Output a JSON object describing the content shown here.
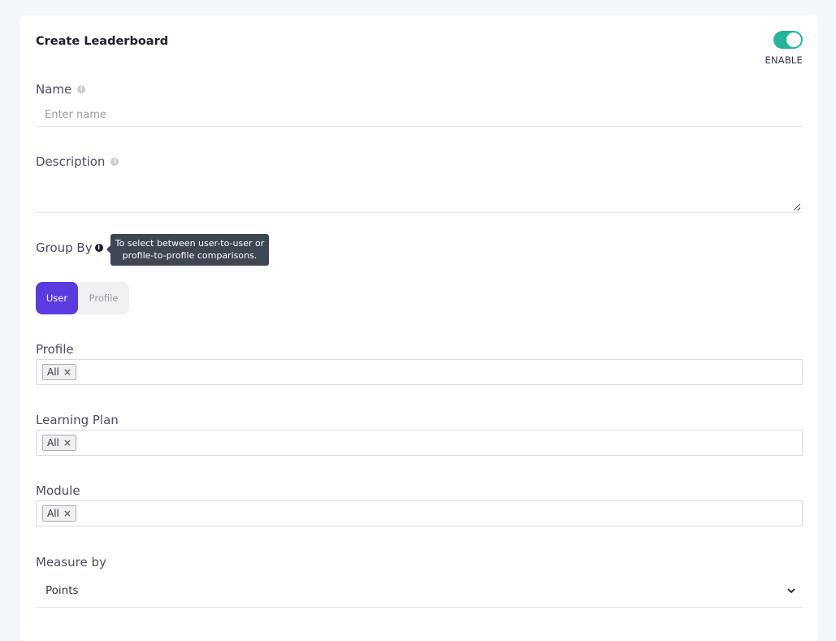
{
  "form": {
    "title": "Create Leaderboard",
    "enable_label": "ENABLE",
    "enabled": true
  },
  "fields": {
    "name": {
      "label": "Name",
      "placeholder": "Enter name",
      "value": ""
    },
    "description": {
      "label": "Description",
      "value": ""
    },
    "group_by": {
      "label": "Group By",
      "tooltip_line1": "To select between user-to-user or",
      "tooltip_line2": "profile-to-profile comparisons.",
      "options": [
        "User",
        "Profile"
      ],
      "selected": "User"
    },
    "profile": {
      "label": "Profile",
      "tags": [
        "All"
      ]
    },
    "learning_plan": {
      "label": "Learning Plan",
      "tags": [
        "All"
      ]
    },
    "module": {
      "label": "Module",
      "tags": [
        "All"
      ]
    },
    "measure_by": {
      "label": "Measure by",
      "value": "Points"
    }
  },
  "icons": {
    "info": "info-icon",
    "remove": "×",
    "chevron": "⌄"
  },
  "colors": {
    "accent": "#5b3be0",
    "toggle_on": "#24b39b",
    "tooltip_bg": "#3d4652"
  }
}
